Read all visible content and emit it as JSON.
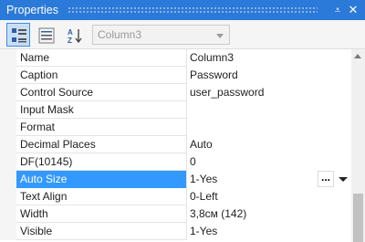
{
  "window": {
    "title": "Properties",
    "pin_glyph": "⩡",
    "close_glyph": "✕"
  },
  "toolbar": {
    "buttons": [
      {
        "icon": "categorized-view-icon",
        "active": true
      },
      {
        "icon": "property-pages-icon",
        "active": false
      },
      {
        "icon": "sort-alphabetical-icon",
        "active": false
      }
    ],
    "object_select": {
      "value": "Column3",
      "enabled": false
    }
  },
  "properties": [
    {
      "name": "Name",
      "value": "Column3"
    },
    {
      "name": "Caption",
      "value": "Password"
    },
    {
      "name": "Control Source",
      "value": "user_password"
    },
    {
      "name": "Input Mask",
      "value": ""
    },
    {
      "name": "Format",
      "value": ""
    },
    {
      "name": "Decimal Places",
      "value": "Auto"
    },
    {
      "name": "DF(10145)",
      "value": "0"
    },
    {
      "name": "Auto Size",
      "value": "1-Yes",
      "selected": true,
      "ellipsis": "...",
      "has_dropdown": true
    },
    {
      "name": "Text Align",
      "value": "0-Left"
    },
    {
      "name": "Width",
      "value": "3,8см (142)"
    },
    {
      "name": "Visible",
      "value": "1-Yes"
    }
  ],
  "colors": {
    "titlebar": "#2b79d8",
    "selection": "#3399ff",
    "active_button": "#c9def5"
  },
  "scroll": {
    "position_fraction": 0.78
  }
}
